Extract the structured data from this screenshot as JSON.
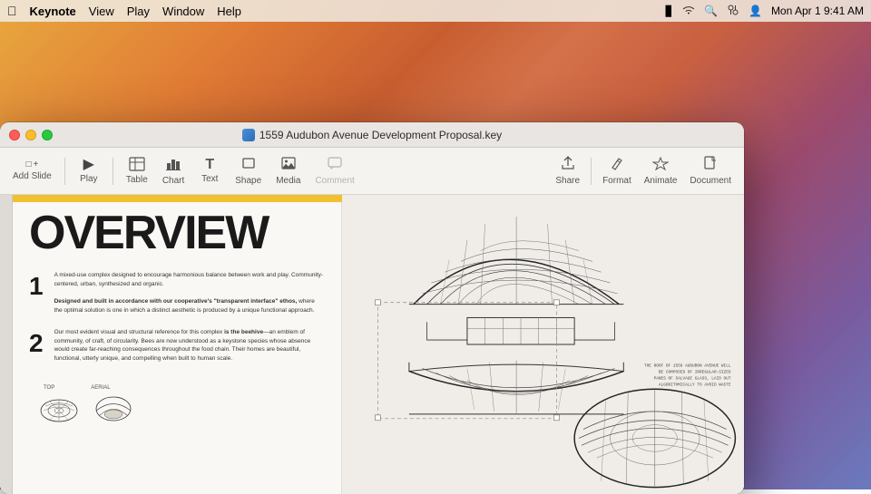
{
  "desktop": {
    "bg_description": "macOS Sonoma wallpaper warm gradient"
  },
  "menubar": {
    "apple": "&#63743;",
    "app_name": "Keynote",
    "menus": [
      "View",
      "Play",
      "Window",
      "Help"
    ],
    "datetime": "Mon Apr 1  9:41 AM",
    "battery": "🔋",
    "wifi": "wifi",
    "search": "search",
    "control_center": "control",
    "user": "user"
  },
  "window": {
    "title": "1559 Audubon Avenue Development Proposal.key",
    "toolbar": {
      "buttons": [
        {
          "id": "add-slide",
          "icon": "➕",
          "label": "Add Slide"
        },
        {
          "id": "play",
          "icon": "▶",
          "label": "Play"
        },
        {
          "id": "table",
          "icon": "⊞",
          "label": "Table"
        },
        {
          "id": "chart",
          "icon": "📊",
          "label": "Chart"
        },
        {
          "id": "text",
          "icon": "T",
          "label": "Text"
        },
        {
          "id": "shape",
          "icon": "◻",
          "label": "Shape"
        },
        {
          "id": "media",
          "icon": "🖼",
          "label": "Media"
        },
        {
          "id": "comment",
          "icon": "💬",
          "label": "Comment"
        },
        {
          "id": "share",
          "icon": "⬆",
          "label": "Share"
        },
        {
          "id": "format",
          "icon": "✏",
          "label": "Format"
        },
        {
          "id": "animate",
          "icon": "✦",
          "label": "Animate"
        },
        {
          "id": "document",
          "icon": "📄",
          "label": "Document"
        }
      ]
    }
  },
  "slide": {
    "title": "OVERVIEW",
    "yellow_bar": true,
    "sections": [
      {
        "number": "1",
        "body": "A mixed-use complex designed to encourage harmonious balance between work and play. Community-centered, urban, synthesized and organic.",
        "bold_part": "Designed and built in accordance with our cooperative's \"transparent interface\" ethos,",
        "body_continued": " where the optimal solution is one in which a distinct aesthetic is produced by a unique functional approach."
      },
      {
        "number": "2",
        "body": "Our most evident visual and structural reference for this complex ",
        "bold_part": "is the beehive",
        "body_continued": "—an emblem of community, of craft, of circularity. Bees are now understood as a keystone species whose absence would create far-reaching consequences throughout the food chain. Their homes are beautiful, functional, utterly unique, and compelling when built to human scale."
      }
    ],
    "annotation": "THE ROOF OF 1559 AUDUBON AVENUE WILL\nBE COMPOSED OF IRREGULAR-SIZED\nPANES OF SALVAGE GLASS, LAID OUT\nALGORITHMICALLY TO AVOID WASTE",
    "labels": [
      "TOP",
      "AERIAL"
    ]
  }
}
